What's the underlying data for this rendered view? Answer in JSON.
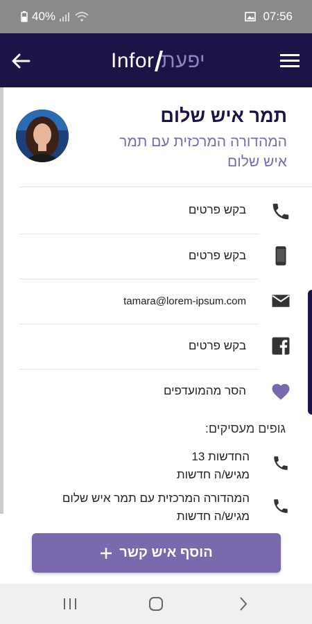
{
  "status_bar": {
    "battery": "40%",
    "time": "07:56"
  },
  "app_bar": {
    "logo_latin": "Infor",
    "logo_hebrew": "יפעת"
  },
  "profile": {
    "name": "תמר איש שלום",
    "subtitle": "המהדורה המרכזית עם תמר איש שלום"
  },
  "contacts": {
    "phone_label": "בקש פרטים",
    "mobile_label": "בקש פרטים",
    "email": "tamara@lorem-ipsum.com",
    "facebook_label": "בקש פרטים",
    "favorite_label": "הסר מהמועדפים"
  },
  "employers": {
    "title": "גופים מעסיקים:",
    "items": [
      {
        "name": "החדשות 13",
        "role": "מגיש/ה חדשות"
      },
      {
        "name": "המהדורה המרכזית עם תמר איש שלום",
        "role": "מגיש/ה חדשות"
      }
    ]
  },
  "add_contact": {
    "label": "הוסף איש קשר"
  },
  "colors": {
    "app_bar": "#1b1446",
    "accent": "#7b69ad",
    "subtitle": "#7a6aae"
  }
}
